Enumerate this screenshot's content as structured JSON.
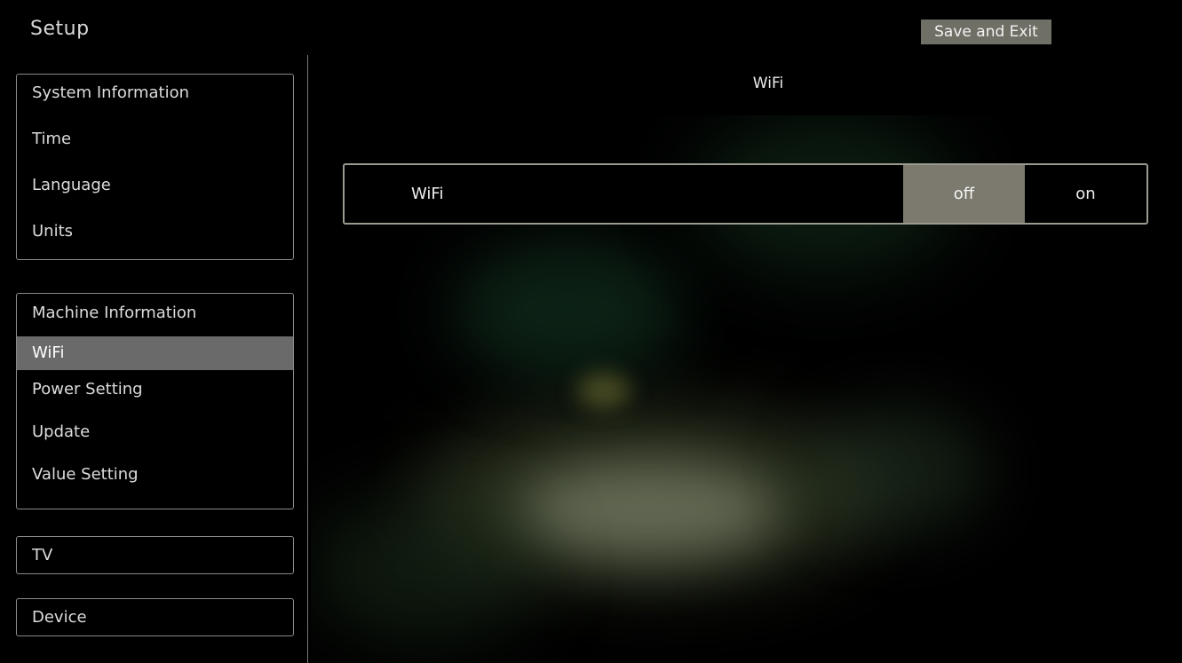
{
  "header": {
    "title": "Setup",
    "save_exit_label": "Save and Exit"
  },
  "sidebar": {
    "group1": [
      {
        "label": "System Information"
      },
      {
        "label": "Time"
      },
      {
        "label": "Language"
      },
      {
        "label": "Units"
      }
    ],
    "group2": [
      {
        "label": "Machine Information"
      },
      {
        "label": "WiFi",
        "active": true
      },
      {
        "label": "Power Setting"
      },
      {
        "label": "Update"
      },
      {
        "label": "Value Setting"
      }
    ],
    "group3": [
      {
        "label": "TV"
      }
    ],
    "group4": [
      {
        "label": "Device"
      }
    ]
  },
  "panel": {
    "title": "WiFi",
    "setting": {
      "label": "WiFi",
      "options": [
        "off",
        "on"
      ],
      "selected": "off"
    }
  },
  "colors": {
    "selected_option": "#7c7a6e",
    "active_item": "#6a6a6a",
    "save_button": "#6f6f66"
  }
}
